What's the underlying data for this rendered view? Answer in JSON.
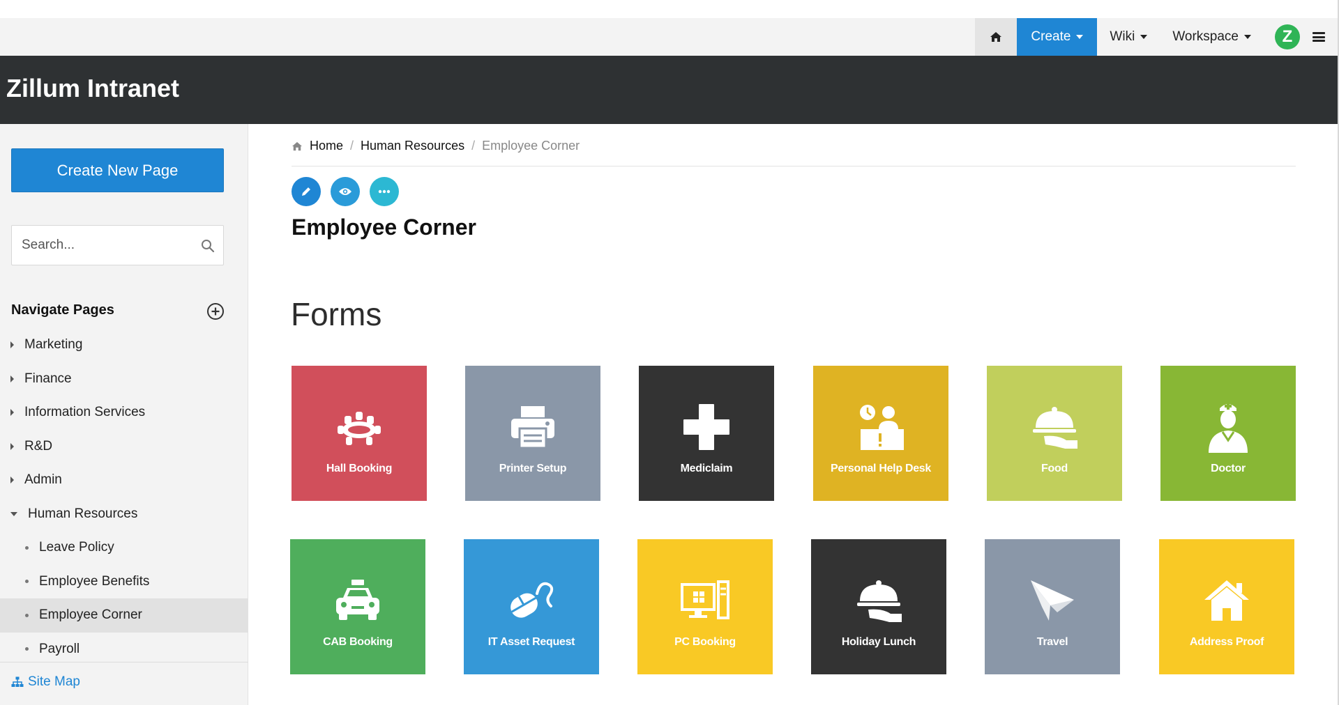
{
  "topnav": {
    "create_label": "Create",
    "wiki_label": "Wiki",
    "workspace_label": "Workspace",
    "avatar_letter": "Z"
  },
  "app": {
    "title": "Zillum Intranet"
  },
  "sidebar": {
    "create_button": "Create New Page",
    "search_placeholder": "Search...",
    "nav_title": "Navigate Pages",
    "items": [
      {
        "label": "Marketing",
        "expanded": false
      },
      {
        "label": "Finance",
        "expanded": false
      },
      {
        "label": "Information Services",
        "expanded": false
      },
      {
        "label": "R&D",
        "expanded": false
      },
      {
        "label": "Admin",
        "expanded": false
      },
      {
        "label": "Human Resources",
        "expanded": true
      }
    ],
    "subitems": [
      {
        "label": "Leave Policy"
      },
      {
        "label": "Employee Benefits"
      },
      {
        "label": "Employee Corner",
        "active": true
      },
      {
        "label": "Payroll"
      }
    ],
    "sitemap": "Site Map"
  },
  "breadcrumb": {
    "home": "Home",
    "section": "Human Resources",
    "current": "Employee Corner",
    "separator": "/"
  },
  "page": {
    "title": "Employee Corner",
    "forms_heading": "Forms"
  },
  "forms": [
    {
      "label": "Hall Booking",
      "icon": "hall-booking-icon",
      "color": "#d14f5b"
    },
    {
      "label": "Printer Setup",
      "icon": "printer-icon",
      "color": "#8a97a8"
    },
    {
      "label": "Mediclaim",
      "icon": "medical-cross-icon",
      "color": "#333333"
    },
    {
      "label": "Personal Help Desk",
      "icon": "help-desk-icon",
      "color": "#dfb323"
    },
    {
      "label": "Food",
      "icon": "food-cloche-icon",
      "color": "#c1cf5c"
    },
    {
      "label": "Doctor",
      "icon": "doctor-icon",
      "color": "#88b735"
    },
    {
      "label": "CAB Booking",
      "icon": "taxi-icon",
      "color": "#4fae5c"
    },
    {
      "label": "IT Asset Request",
      "icon": "mouse-icon",
      "color": "#3598d7"
    },
    {
      "label": "PC Booking",
      "icon": "desktop-pc-icon",
      "color": "#f9c925"
    },
    {
      "label": "Holiday Lunch",
      "icon": "serving-tray-icon",
      "color": "#333333"
    },
    {
      "label": "Travel",
      "icon": "paper-plane-icon",
      "color": "#8a97a8"
    },
    {
      "label": "Address Proof",
      "icon": "house-icon",
      "color": "#f9c925"
    }
  ],
  "colors": {
    "accent": "#1f86d4",
    "banner": "#2e3133",
    "sidebar_bg": "#f3f3f3"
  }
}
